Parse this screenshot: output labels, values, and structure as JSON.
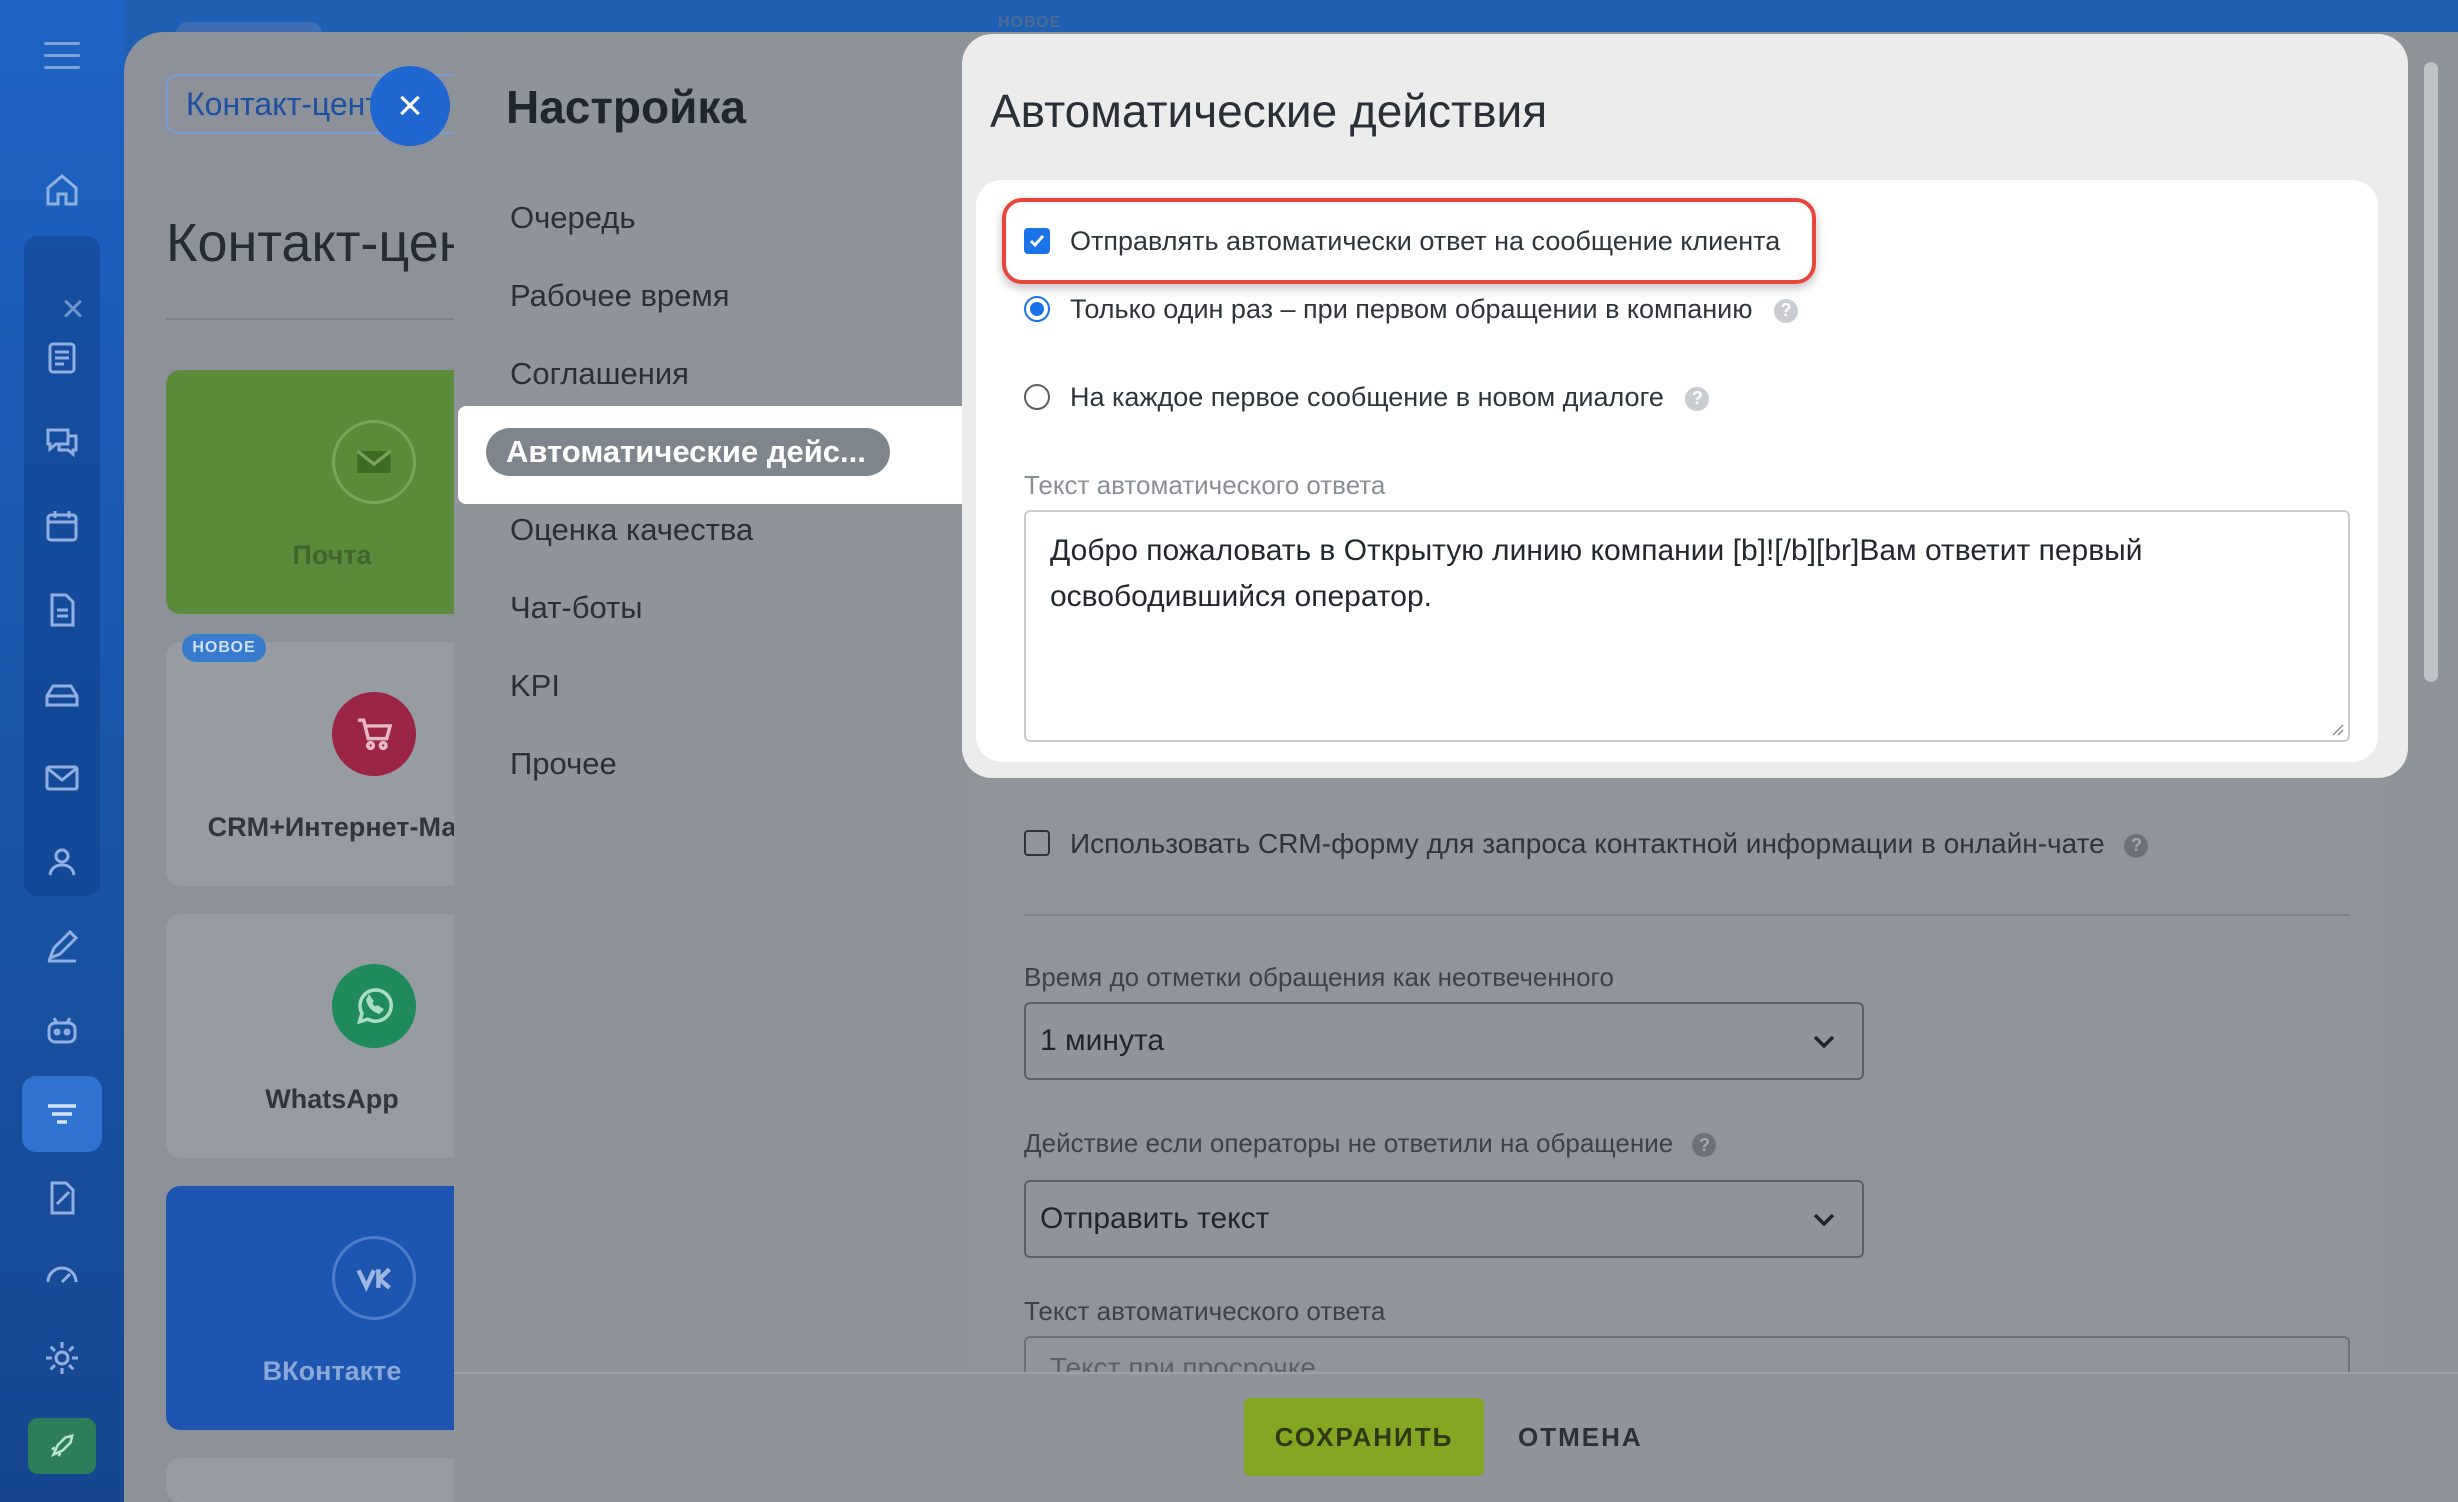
{
  "workspace": {
    "tab_label": "Контакт-цент",
    "close_symbol": "×",
    "title": "Контакт-цен",
    "new_badge": "НОВОЕ",
    "cards": [
      {
        "label": "Почта",
        "icon": "mail-icon",
        "color": "#5a8a3a"
      },
      {
        "label": "CRM+Интернет-Ма",
        "icon": "shop-cart-icon",
        "color": "#9b2545"
      },
      {
        "label": "WhatsApp",
        "icon": "whatsapp-icon",
        "color": "#1f8a5a"
      },
      {
        "label": "ВКонтакте",
        "icon": "vk-icon",
        "color": "#1d55b0"
      }
    ]
  },
  "top_badge": "НОВОЕ",
  "settings": {
    "title": "Настройка",
    "menu": [
      {
        "label": "Очередь",
        "active": false
      },
      {
        "label": "Рабочее время",
        "active": false
      },
      {
        "label": "Соглашения",
        "active": false
      },
      {
        "label": "Автоматические дейс...",
        "active": true
      },
      {
        "label": "Оценка качества",
        "active": false
      },
      {
        "label": "Чат-боты",
        "active": false
      },
      {
        "label": "KPI",
        "active": false
      },
      {
        "label": "Прочее",
        "active": false
      }
    ]
  },
  "auto_actions": {
    "title": "Автоматические действия",
    "send_auto_reply": {
      "label": "Отправлять автоматически ответ на сообщение клиента",
      "checked": true
    },
    "options": [
      {
        "label": "Только один раз – при первом обращении в компанию",
        "selected": true
      },
      {
        "label": "На каждое первое сообщение в новом диалоге",
        "selected": false
      }
    ],
    "reply_text_label": "Текст автоматического ответа",
    "reply_text_value": "Добро пожаловать в Открытую линию компании [b]![/b][br]Вам ответит первый освободившийся оператор."
  },
  "more_settings": {
    "crm_form_label": "Использовать CRM-форму для запроса контактной информации в онлайн-чате",
    "crm_form_checked": false,
    "unanswered_time_label": "Время до отметки обращения как неотвеченного",
    "unanswered_time_value": "1 минута",
    "no_answer_action_label": "Действие если операторы не ответили на обращение",
    "no_answer_action_value": "Отправить текст",
    "timeout_text_label": "Текст автоматического ответа",
    "timeout_text_placeholder": "Текст при просрочке"
  },
  "footer": {
    "save_label": "СОХРАНИТЬ",
    "cancel_label": "ОТМЕНА"
  },
  "help_symbol": "?",
  "colors": {
    "accent_blue": "#1a73e8",
    "save_green": "#83a623",
    "highlight_red": "#e8453c"
  }
}
